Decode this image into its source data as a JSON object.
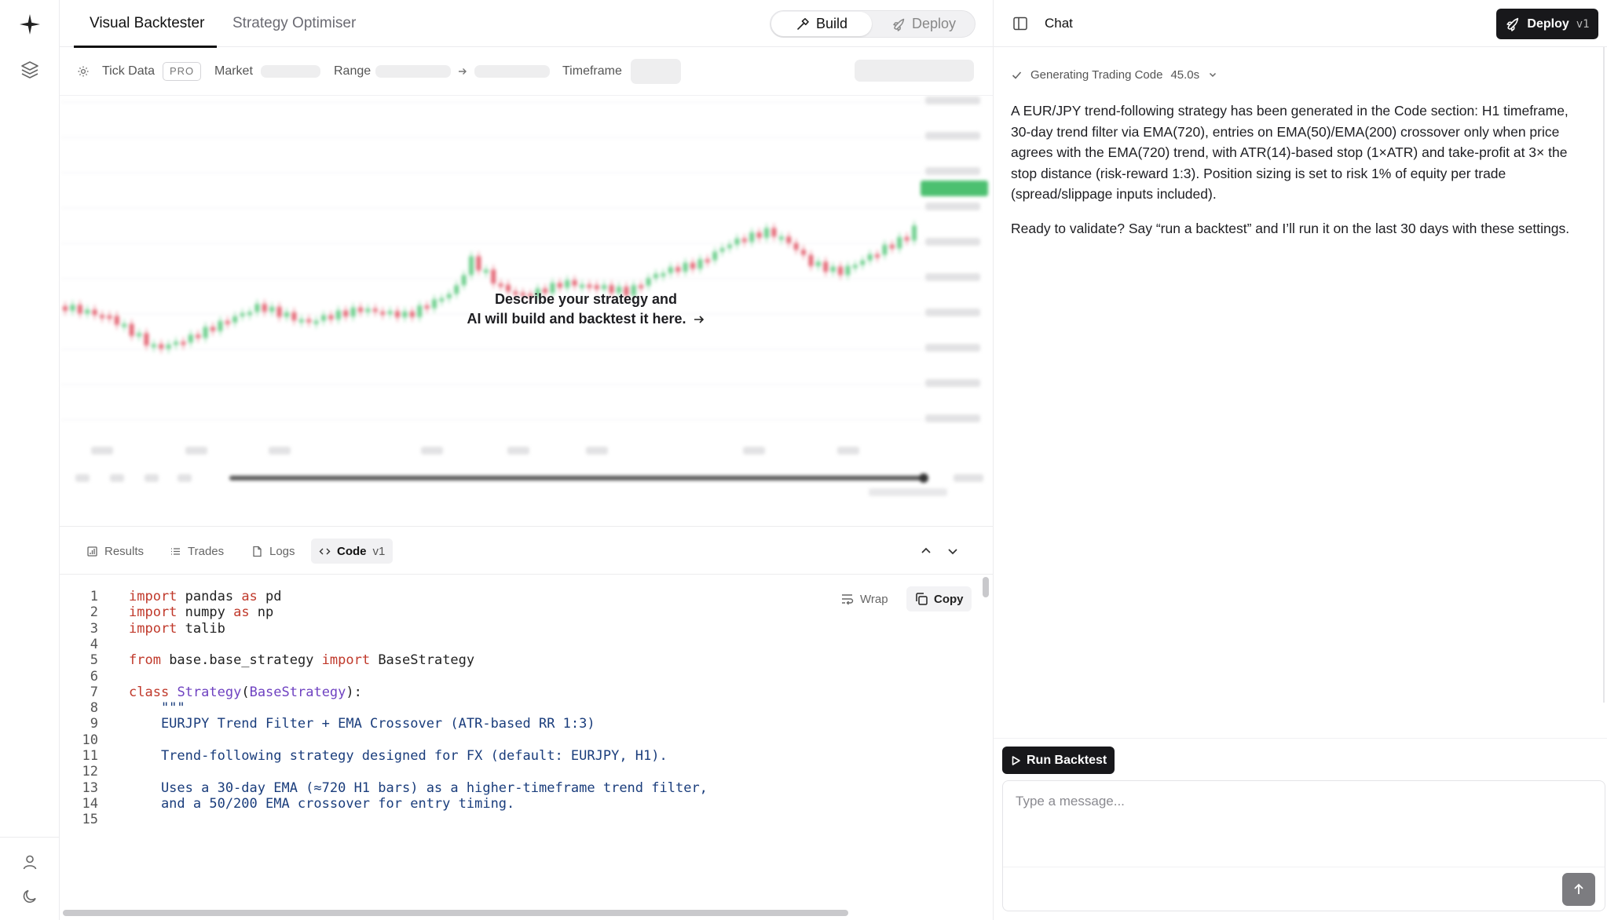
{
  "nav": {
    "tabs": [
      "Visual Backtester",
      "Strategy Optimiser"
    ],
    "mode_toggle": {
      "build": "Build",
      "deploy": "Deploy"
    }
  },
  "filters": {
    "tick_data": "Tick Data",
    "pro_badge": "PRO",
    "market": "Market",
    "range": "Range",
    "timeframe": "Timeframe"
  },
  "chart": {
    "placeholder_line1": "Describe your strategy and",
    "placeholder_line2": "AI will build and backtest it here."
  },
  "bottom_tabs": {
    "results": "Results",
    "trades": "Trades",
    "logs": "Logs",
    "code": "Code",
    "code_version": "v1"
  },
  "code_panel": {
    "wrap": "Wrap",
    "copy": "Copy",
    "lines": [
      "import pandas as pd",
      "import numpy as np",
      "import talib",
      "",
      "from base.base_strategy import BaseStrategy",
      "",
      "class Strategy(BaseStrategy):",
      "    \"\"\"",
      "    EURJPY Trend Filter + EMA Crossover (ATR-based RR 1:3)",
      "",
      "    Trend-following strategy designed for FX (default: EURJPY, H1).",
      "",
      "    Uses a 30-day EMA (≈720 H1 bars) as a higher-timeframe trend filter,",
      "    and a 50/200 EMA crossover for entry timing.",
      ""
    ]
  },
  "chat": {
    "title": "Chat",
    "deploy_label": "Deploy",
    "deploy_version": "v1",
    "status_label": "Generating Trading Code",
    "status_time": "45.0s",
    "message_p1": "A EUR/JPY trend-following strategy has been generated in the Code section: H1 timeframe, 30-day trend filter via EMA(720), entries on EMA(50)/EMA(200) crossover only when price agrees with the EMA(720) trend, with ATR(14)-based stop (1×ATR) and take-profit at 3× the stop distance (risk-reward 1:3). Position sizing is set to risk 1% of equity per trade (spread/slippage inputs included).",
    "message_p2": "Ready to validate? Say “run a backtest” and I’ll run it on the last 30 days with these settings.",
    "run_backtest": "Run Backtest",
    "input_placeholder": "Type a message..."
  },
  "colors": {
    "up_candle": "#6fcf8e",
    "down_candle": "#e46a78",
    "price_tag": "#4cc070",
    "primary_dark": "#18181b"
  }
}
